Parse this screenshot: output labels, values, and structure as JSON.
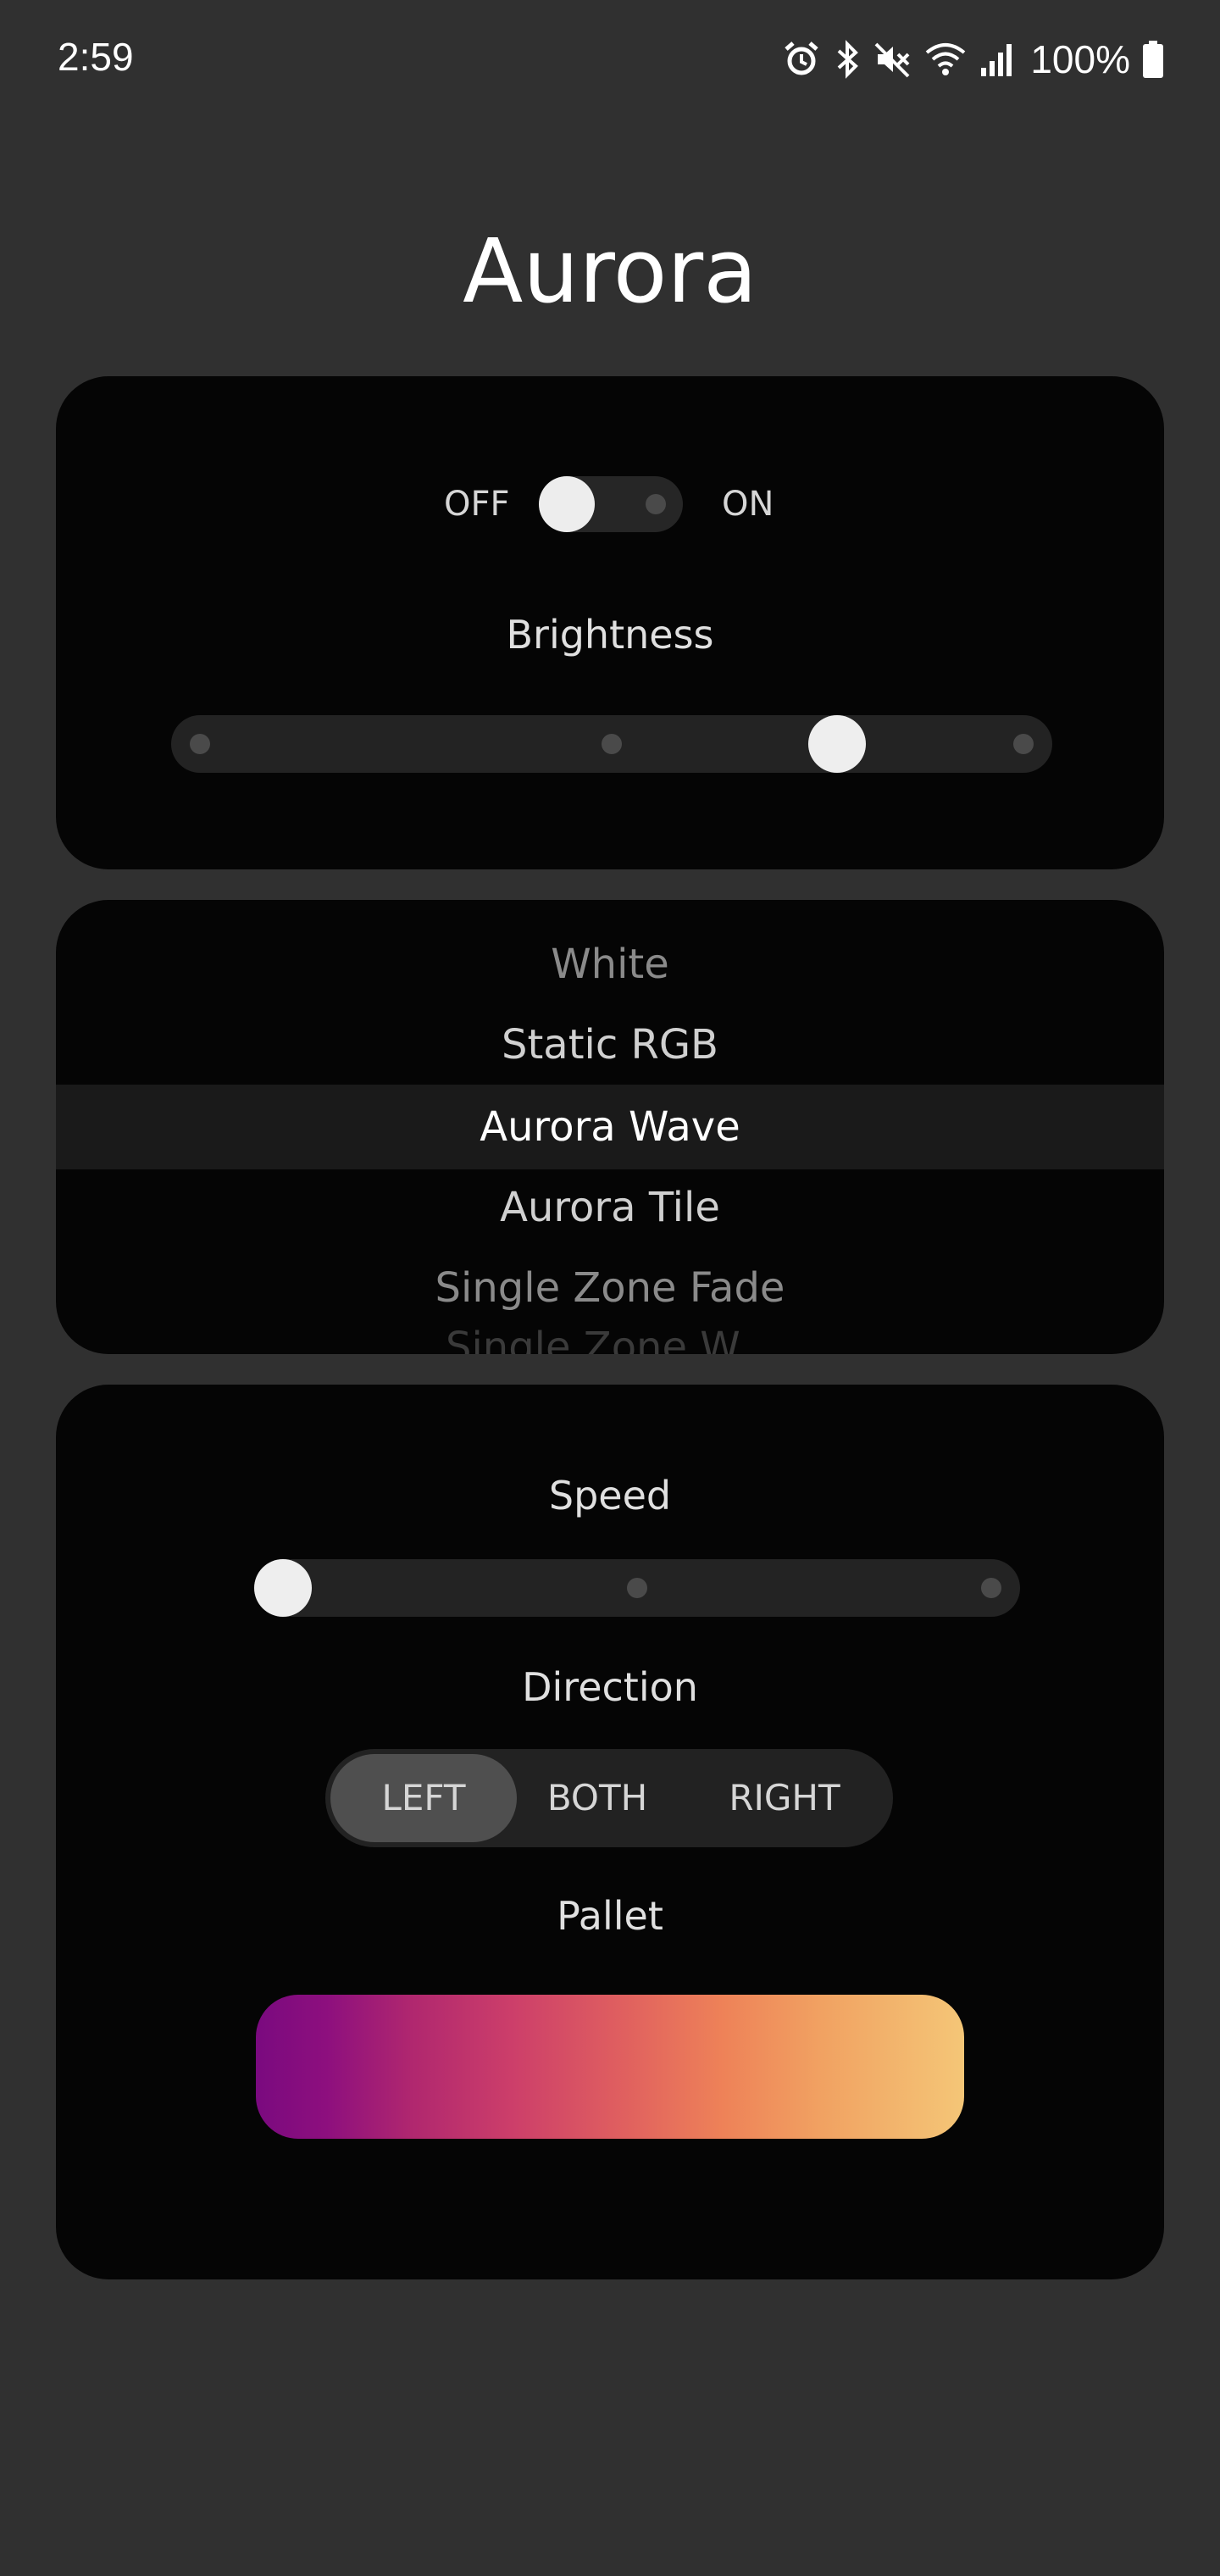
{
  "status_bar": {
    "time": "2:59",
    "icons": [
      "alarm-icon",
      "bluetooth-icon",
      "mute-icon",
      "wifi-icon",
      "signal-icon",
      "battery-icon"
    ],
    "battery": "100%"
  },
  "title": "Aurora",
  "power": {
    "off_label": "OFF",
    "on_label": "ON",
    "state": "off"
  },
  "brightness": {
    "label": "Brightness",
    "level": 0.75,
    "steps": 4
  },
  "modes": {
    "items": [
      "White",
      "Static RGB",
      "Aurora Wave",
      "Aurora Tile",
      "Single Zone Fade",
      "Single Zone W..."
    ],
    "selected": "Aurora Wave"
  },
  "speed": {
    "label": "Speed",
    "level": 0,
    "steps": 3
  },
  "direction": {
    "label": "Direction",
    "options": [
      "LEFT",
      "BOTH",
      "RIGHT"
    ],
    "selected": "LEFT"
  },
  "pallet": {
    "label": "Pallet",
    "colors": [
      "#7a0a7f",
      "#b0276f",
      "#e0605f",
      "#f1a262",
      "#f4c677"
    ]
  }
}
